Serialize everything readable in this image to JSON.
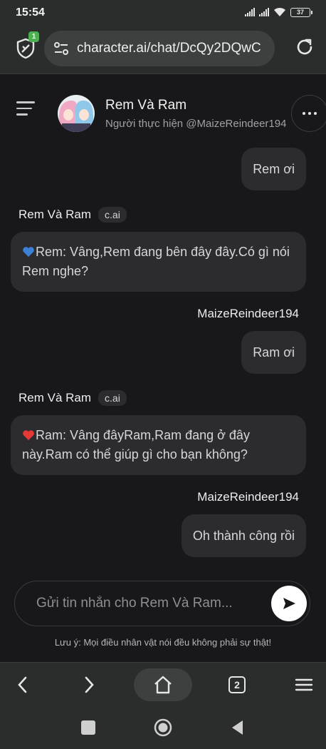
{
  "status_bar": {
    "time": "15:54",
    "battery": "37"
  },
  "browser": {
    "url": "character.ai/chat/DcQy2DQwC",
    "shield_count": "1",
    "tab_count": "2"
  },
  "header": {
    "character_name": "Rem Và Ram",
    "creator": "Người thực hiện @MaizeReindeer194"
  },
  "messages": [
    {
      "role": "user",
      "text": "Rem ơi"
    },
    {
      "role": "bot",
      "name": "Rem Và Ram",
      "badge": "c.ai",
      "text": "Rem: Vâng,Rem đang bên đây đây.Có gì nói Rem nghe?",
      "emoji": "blue-heart-icon"
    },
    {
      "role": "user",
      "name": "MaizeReindeer194",
      "text": "Ram ơi"
    },
    {
      "role": "bot",
      "name": "Rem Và Ram",
      "badge": "c.ai",
      "text": "Ram: Vâng đâyRam,Ram đang ở đây này.Ram có thể giúp gì cho bạn không?",
      "emoji": "red-heart-icon"
    },
    {
      "role": "user",
      "name": "MaizeReindeer194",
      "text": "Oh thành công rồi"
    }
  ],
  "composer": {
    "placeholder": "Gửi tin nhắn cho Rem Và Ram..."
  },
  "disclaimer": "Lưu ý: Mọi điều nhân vật nói đều không phải sự thật!",
  "colors": {
    "background": "#18181b",
    "bubble": "#2b2b30",
    "browser_chrome": "#2a2d2c",
    "blue_heart": "#3b82d6",
    "red_heart": "#e53935"
  }
}
